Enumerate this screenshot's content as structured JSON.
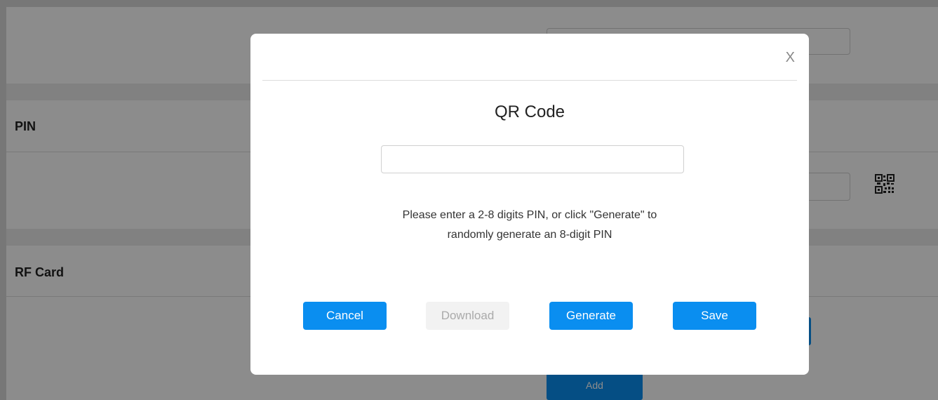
{
  "background": {
    "sections": [
      {
        "title": "PIN"
      },
      {
        "title": "RF Card"
      }
    ],
    "add_button_label": "Add",
    "qr_icon_name": "qr-code-icon"
  },
  "modal": {
    "close_label": "X",
    "title": "QR Code",
    "input": {
      "value": "",
      "placeholder": ""
    },
    "hint_line1": "Please enter a 2-8 digits PIN, or click \"Generate\" to",
    "hint_line2": "randomly generate an 8-digit PIN",
    "buttons": {
      "cancel": "Cancel",
      "download": "Download",
      "generate": "Generate",
      "save": "Save"
    }
  },
  "colors": {
    "primary": "#0a8ef0",
    "disabled_bg": "#f2f2f2",
    "disabled_text": "#aaaaaa"
  }
}
